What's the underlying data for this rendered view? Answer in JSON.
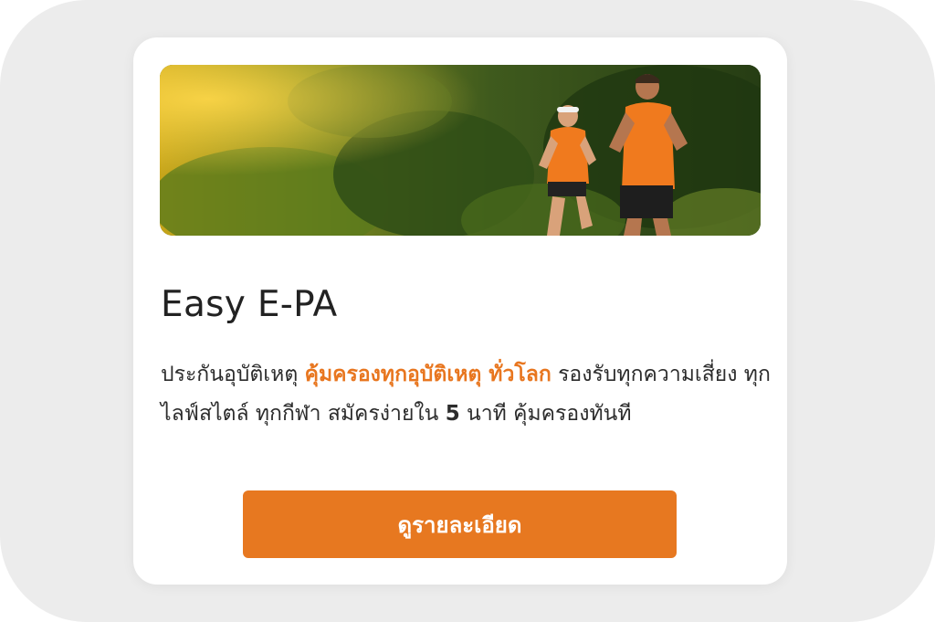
{
  "card": {
    "title": "Easy E-PA",
    "description": {
      "part1": "ประกันอุบัติเหตุ ",
      "highlight": "คุ้มครองทุกอุบัติเหตุ ทั่วโลก",
      "part2": " รองรับทุกความเสี่ยง ทุกไลฟ์สไตล์ ทุกกีฬา สมัครง่ายใน ",
      "number": "5",
      "part3": " นาที คุ้มครองทันที"
    },
    "button_label": "ดูรายละเอียด",
    "image_alt": "runners-jogging-in-forest"
  },
  "colors": {
    "accent": "#e8761f",
    "button": "#e77820",
    "page_background": "#ececec",
    "card_background": "#ffffff"
  }
}
